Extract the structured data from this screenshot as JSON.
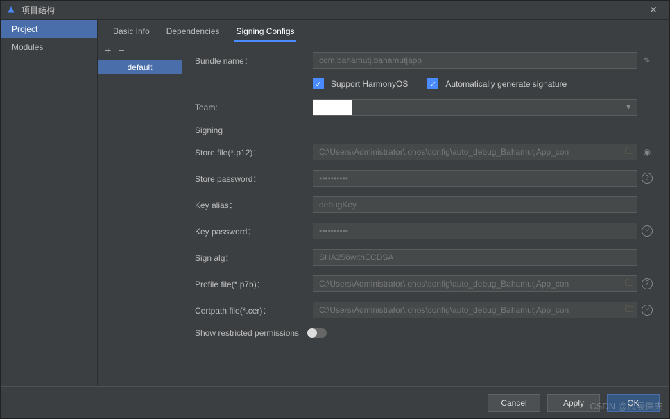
{
  "window": {
    "title": "项目结构"
  },
  "sidebar": {
    "items": [
      "Project",
      "Modules"
    ],
    "active": 0
  },
  "tabs": {
    "items": [
      "Basic Info",
      "Dependencies",
      "Signing Configs"
    ],
    "active": 2
  },
  "configs": {
    "items": [
      "default"
    ],
    "active": 0
  },
  "form": {
    "bundle_label": "Bundle name：",
    "bundle_value": "com.bahamutj.bahamutjapp",
    "support_label": "Support HarmonyOS",
    "auto_sign_label": "Automatically generate signature",
    "team_label": "Team:",
    "team_value": "",
    "signing_hdr": "Signing",
    "store_file_label": "Store file(*.p12)：",
    "store_file_value": "C:\\Users\\Administrator\\.ohos\\config\\auto_debug_BahamutjApp_con",
    "store_pw_label": "Store password：",
    "store_pw_value": "••••••••••",
    "key_alias_label": "Key alias：",
    "key_alias_value": "debugKey",
    "key_pw_label": "Key password：",
    "key_pw_value": "••••••••••",
    "sign_alg_label": "Sign alg：",
    "sign_alg_value": "SHA256withECDSA",
    "profile_label": "Profile file(*.p7b)：",
    "profile_value": "C:\\Users\\Administrator\\.ohos\\config\\auto_debug_BahamutjApp_con",
    "cert_label": "Certpath file(*.cer)：",
    "cert_value": "C:\\Users\\Administrator\\.ohos\\config\\auto_debug_BahamutjApp_con",
    "perm_label": "Show restricted permissions"
  },
  "footer": {
    "cancel": "Cancel",
    "apply": "Apply",
    "ok": "OK"
  },
  "watermark": "CSDN @武陵悍夫"
}
